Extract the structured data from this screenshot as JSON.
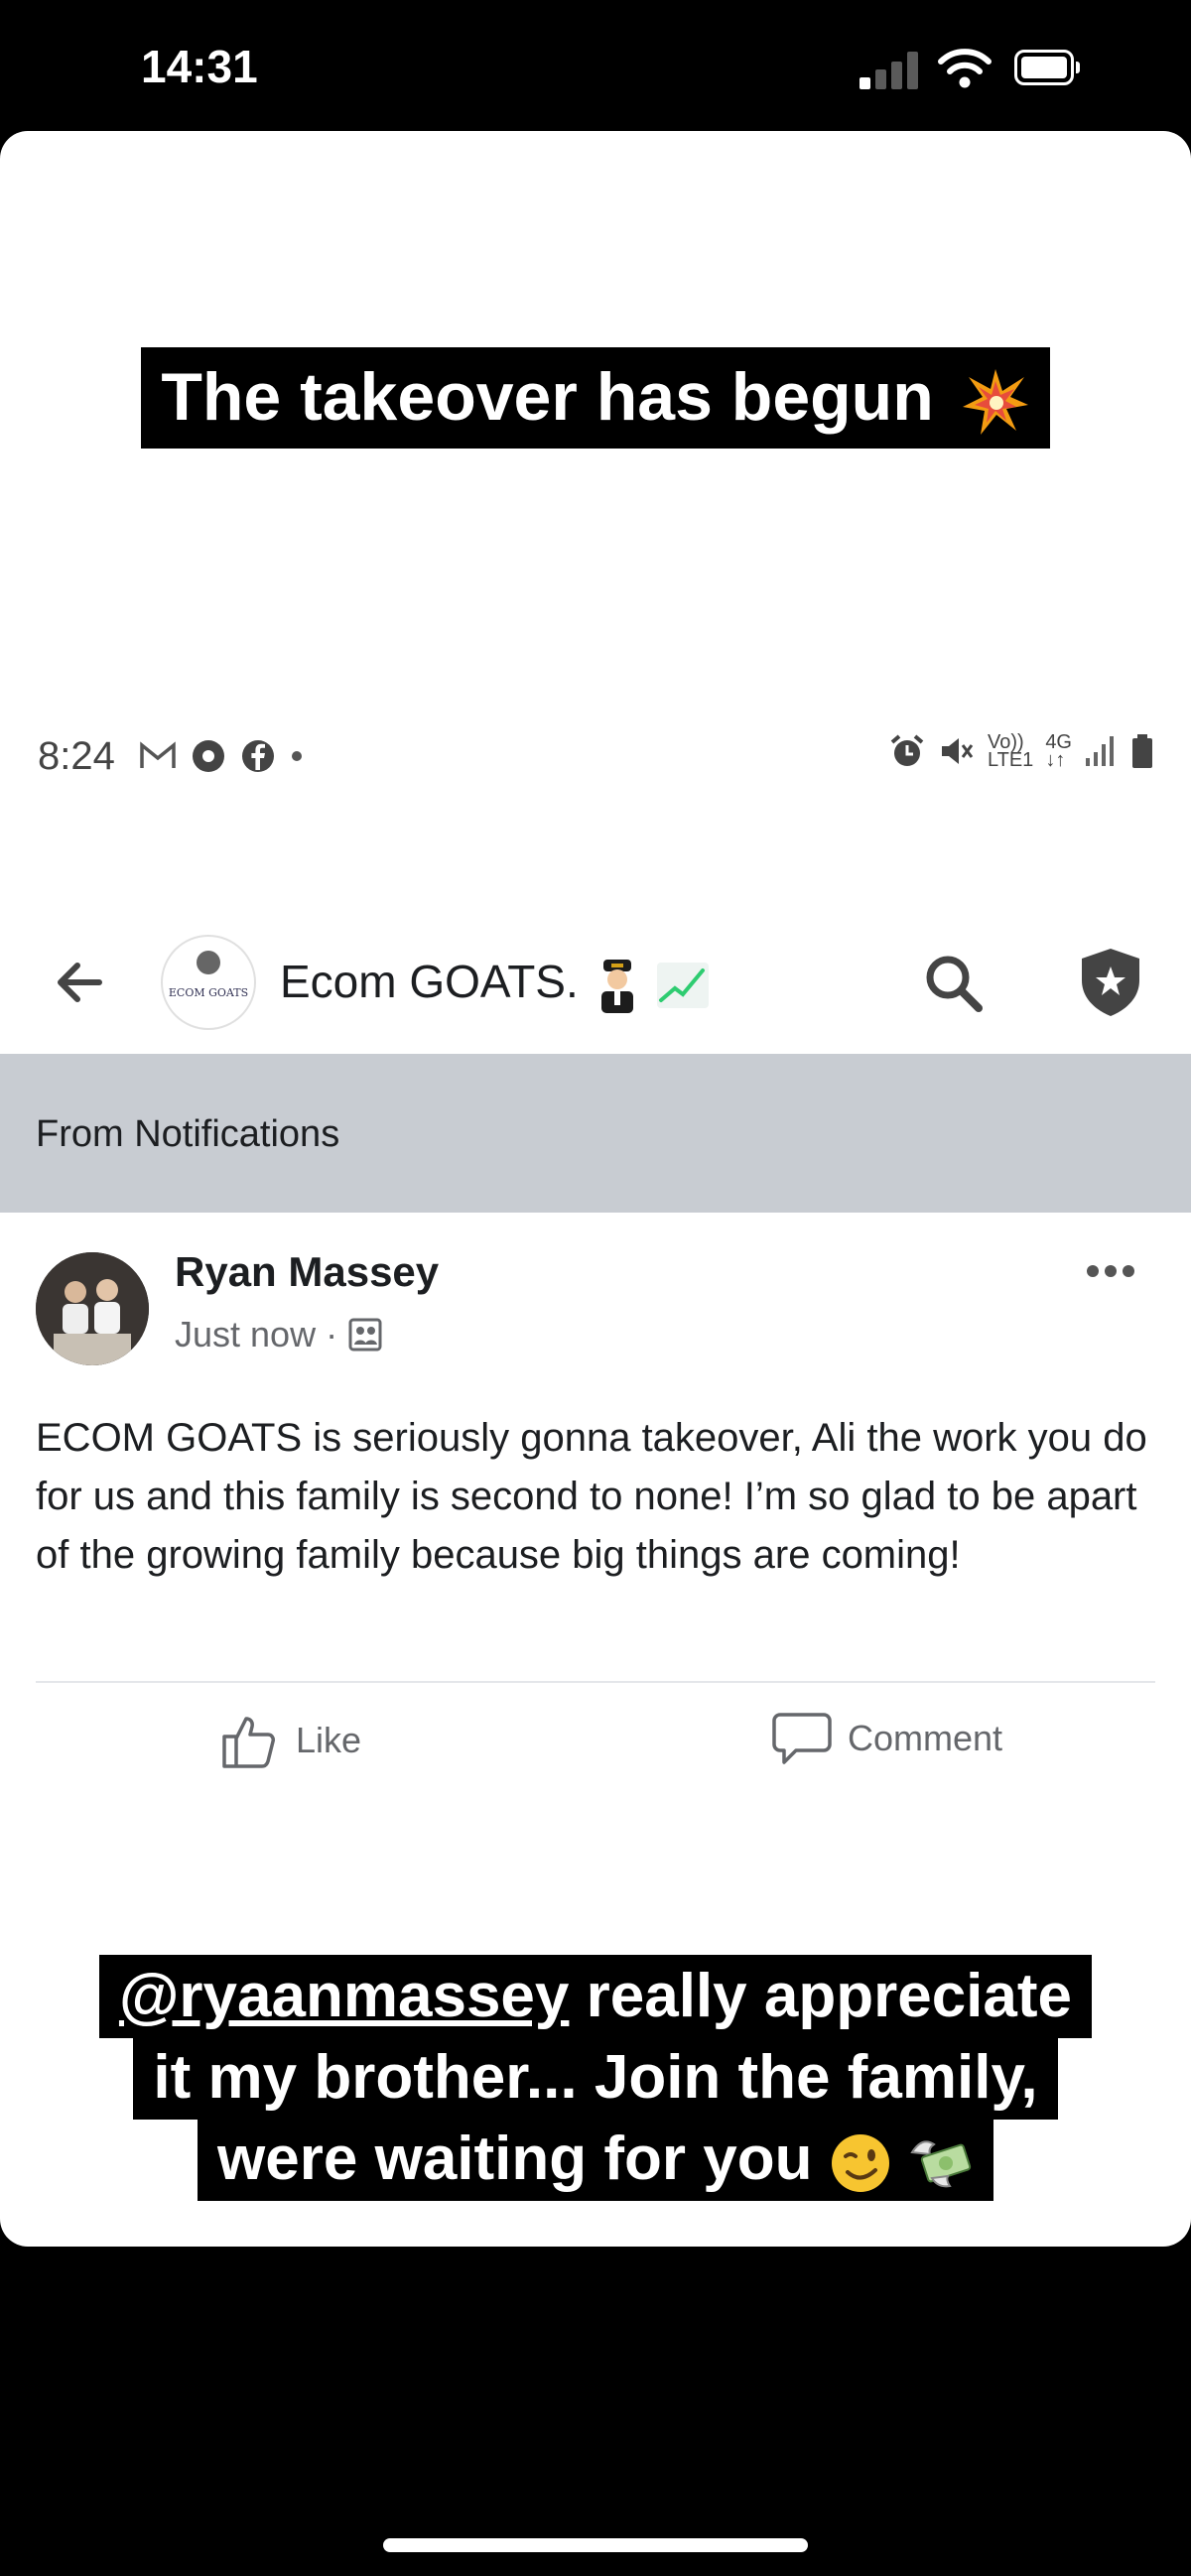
{
  "ios_status": {
    "time": "14:31"
  },
  "story": {
    "caption_top": "The takeover has begun",
    "caption_top_emoji": "collision-emoji",
    "caption_bottom": {
      "mention": "@ryaanmassey",
      "line1_rest": " really appreciate",
      "line2": "it my brother... Join the family,",
      "line3": "were waiting for you",
      "emojis": [
        "winking-face-emoji",
        "money-with-wings-emoji"
      ]
    }
  },
  "android_status": {
    "time": "8:24",
    "network": "4G",
    "volte": "Vo))",
    "lte": "LTE1"
  },
  "group_header": {
    "title": "Ecom GOATS.",
    "logo_text": "ECOM GOATS"
  },
  "notification_banner": {
    "label": "From Notifications"
  },
  "post": {
    "author": "Ryan Massey",
    "timestamp": "Just now",
    "body": "ECOM GOATS is seriously gonna takeover, Ali the work you do for us and this family is second to none! I’m so glad to be apart of the growing family because big things are coming!",
    "actions": {
      "like": "Like",
      "comment": "Comment"
    }
  },
  "colors": {
    "notification_bg": "#c8ccd2",
    "text_primary": "#1c1e21",
    "text_secondary": "#65676b"
  }
}
